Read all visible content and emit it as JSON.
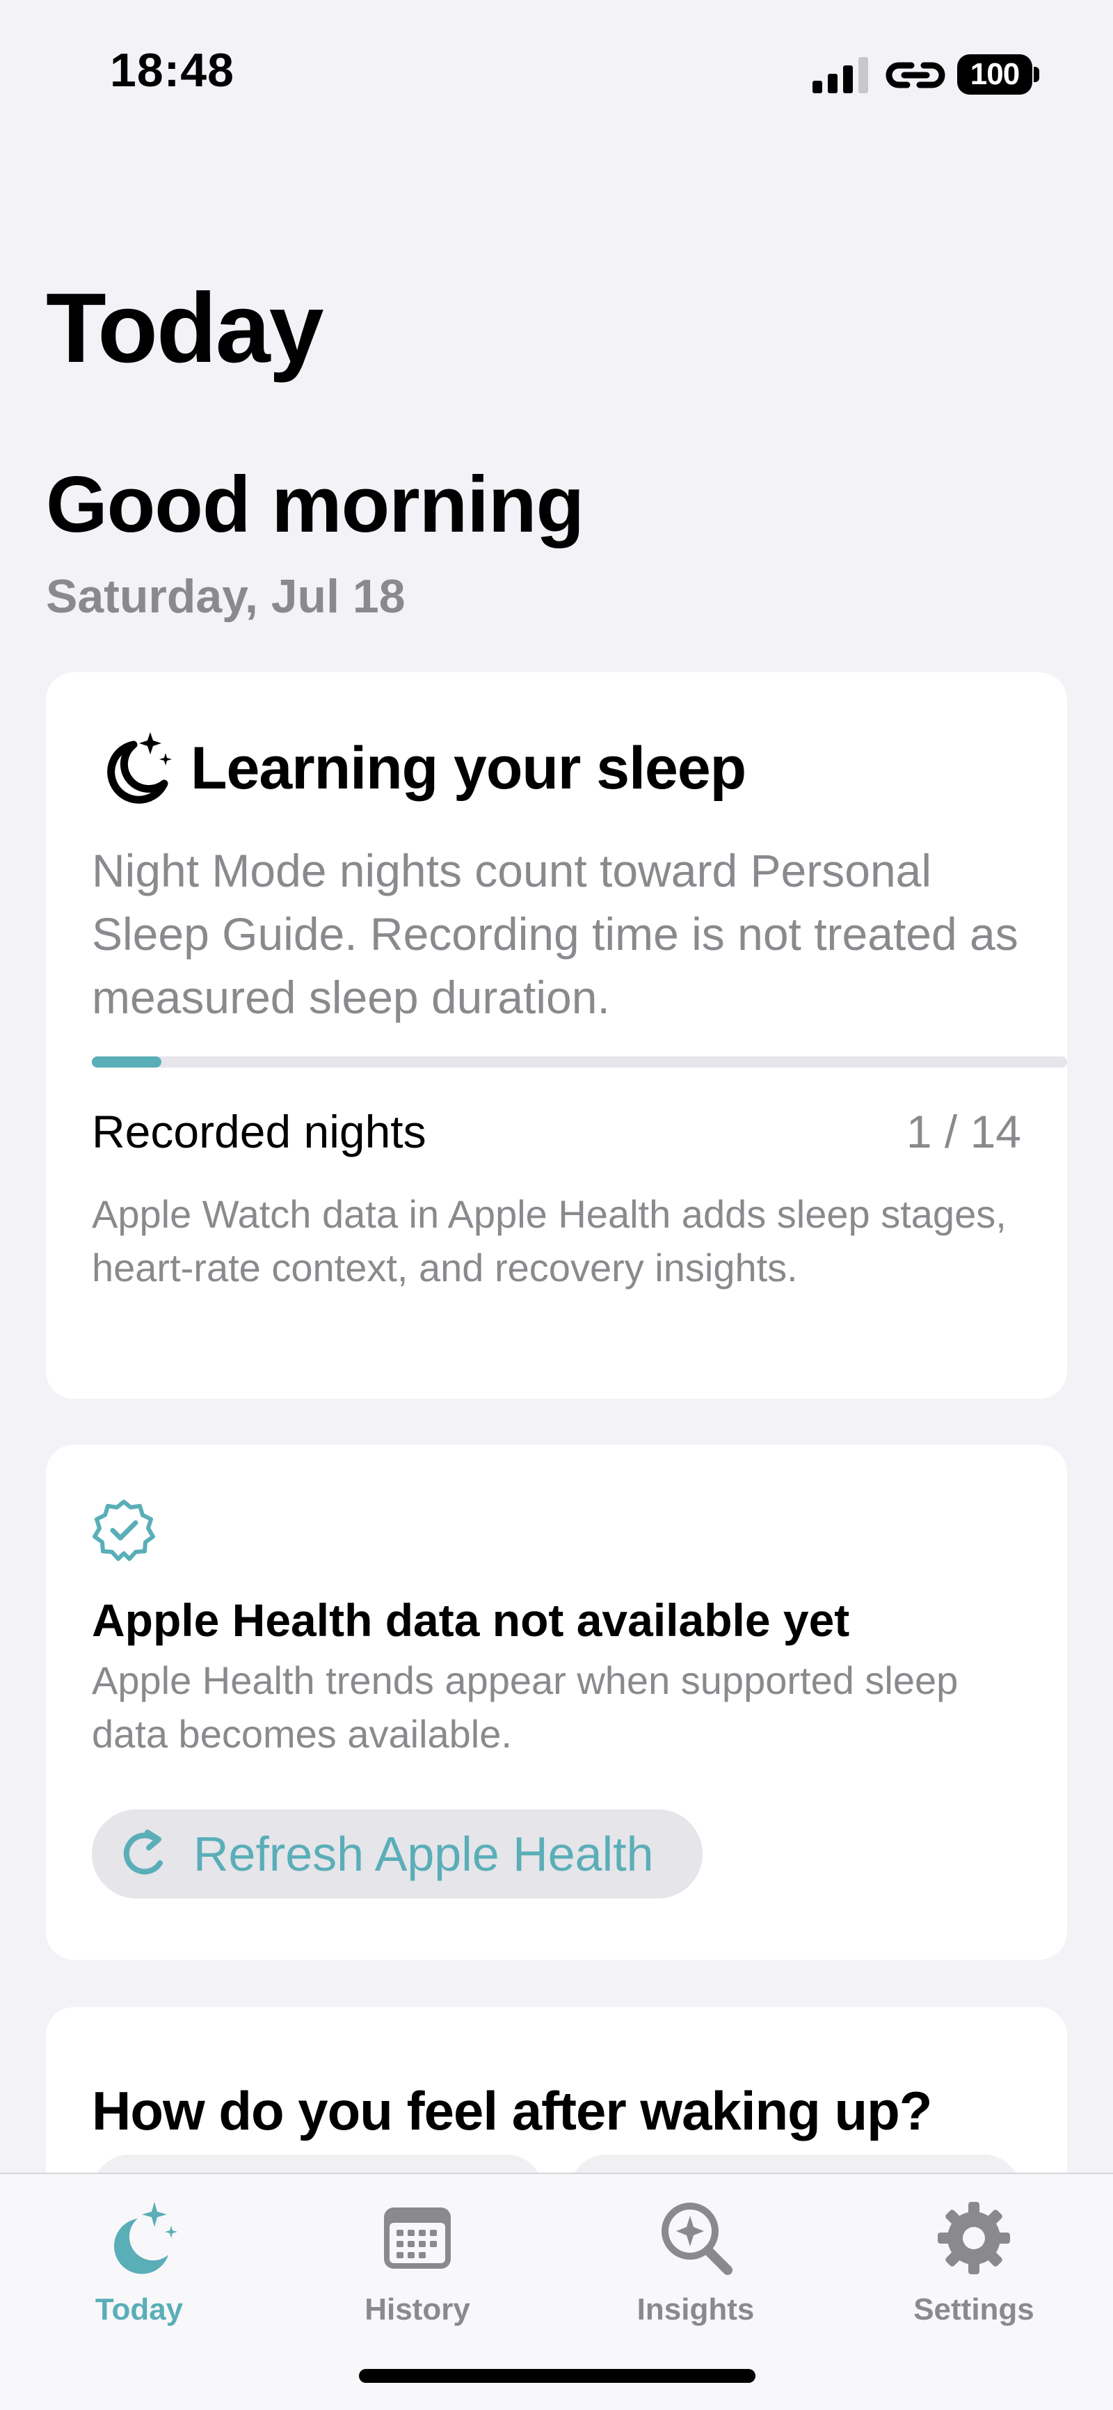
{
  "status_bar": {
    "time": "18:48",
    "battery": "100"
  },
  "page": {
    "large_title": "Today",
    "greeting": "Good morning",
    "date": "Saturday, Jul 18"
  },
  "sleep_card": {
    "icon": "moon-stars-icon",
    "title": "Learning your sleep",
    "description": "Night Mode nights count toward Personal Sleep Guide. Recording time is not treated as measured sleep duration.",
    "progress": {
      "recorded": 1,
      "total": 14
    },
    "recorded_label": "Recorded nights",
    "recorded_value": "1 / 14",
    "note": "Apple Watch data in Apple Health adds sleep stages, heart-rate context, and recovery insights."
  },
  "health_card": {
    "icon": "checkmark-seal-icon",
    "title": "Apple Health data not available yet",
    "description": "Apple Health trends appear when supported sleep data becomes available.",
    "button_label": "Refresh Apple Health",
    "button_icon": "refresh-icon"
  },
  "feel_card": {
    "title": "How do you feel after waking up?"
  },
  "tab_bar": {
    "items": [
      {
        "label": "Today",
        "icon": "moon-stars-icon",
        "active": true
      },
      {
        "label": "History",
        "icon": "calendar-icon",
        "active": false
      },
      {
        "label": "Insights",
        "icon": "sparkle-search-icon",
        "active": false
      },
      {
        "label": "Settings",
        "icon": "gear-icon",
        "active": false
      }
    ]
  },
  "colors": {
    "accent": "#5aaeb8",
    "background": "#f2f2f7",
    "secondary_text": "#8a8a8e",
    "card": "#ffffff"
  }
}
